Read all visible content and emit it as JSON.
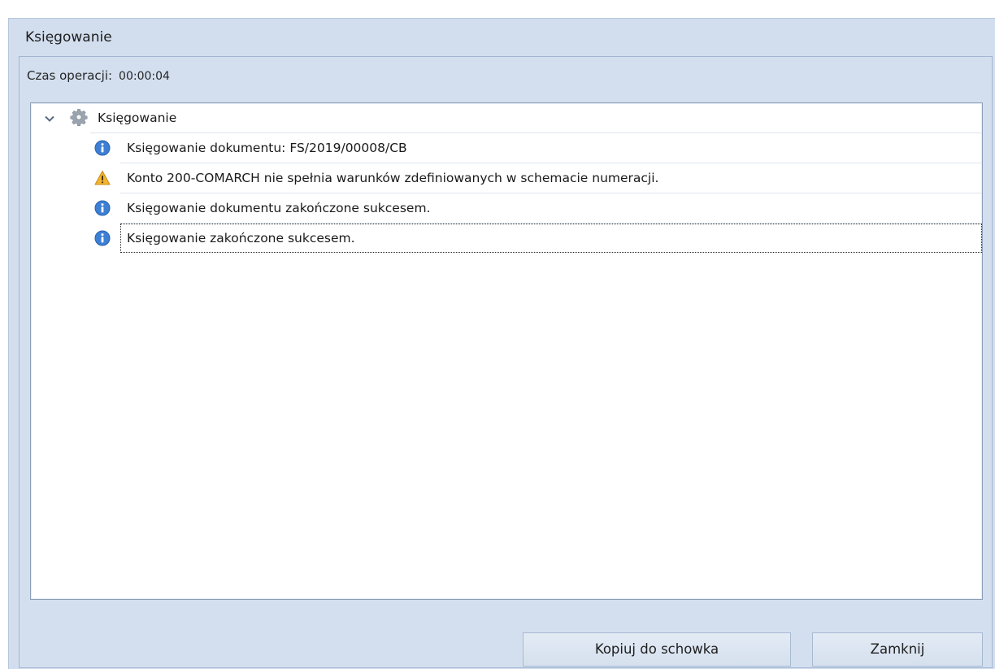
{
  "window": {
    "title": "Księgowanie"
  },
  "operation": {
    "label": "Czas operacji:",
    "time": "00:00:04"
  },
  "tree": {
    "root": {
      "label": "Księgowanie",
      "expanded": true,
      "icon": "gear-icon"
    },
    "items": [
      {
        "icon": "info-icon",
        "text": "Księgowanie dokumentu: FS/2019/00008/CB"
      },
      {
        "icon": "warning-icon",
        "text": "Konto 200-COMARCH nie spełnia warunków zdefiniowanych w schemacie numeracji."
      },
      {
        "icon": "info-icon",
        "text": "Księgowanie dokumentu zakończone sukcesem."
      },
      {
        "icon": "info-icon",
        "text": "Księgowanie zakończone sukcesem.",
        "focused": true
      }
    ]
  },
  "buttons": {
    "copy": "Kopiuj do schowka",
    "close": "Zamknij"
  },
  "colors": {
    "window_bg": "#d2deee",
    "info": "#3d7fd4",
    "warning": "#f2b530"
  }
}
